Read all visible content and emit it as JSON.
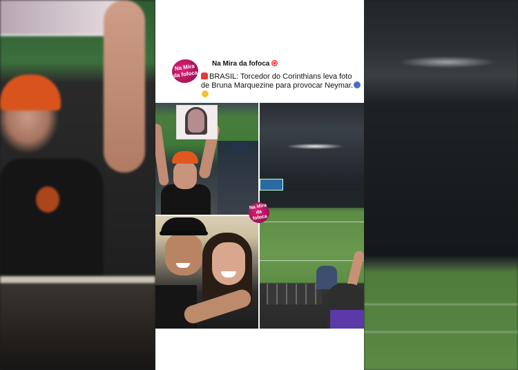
{
  "post": {
    "account_name": "Na Mira da fofoca",
    "avatar_text": "Na Mira da fofoca",
    "caption": "BRASIL: Torcedor do Corinthians leva foto de Bruna Marquezine para provocar Neymar.",
    "watermark_text": "Na Mira da fofoca"
  },
  "icons": {
    "name_badge": "target-emoji-icon",
    "caption_prefix": "siren-emoji-icon",
    "caption_suffix": [
      "speaking-head-emoji-icon",
      "laughing-tears-emoji-icon"
    ]
  },
  "colors": {
    "brand_magenta": "#e0217a",
    "card_bg": "#ffffff"
  }
}
